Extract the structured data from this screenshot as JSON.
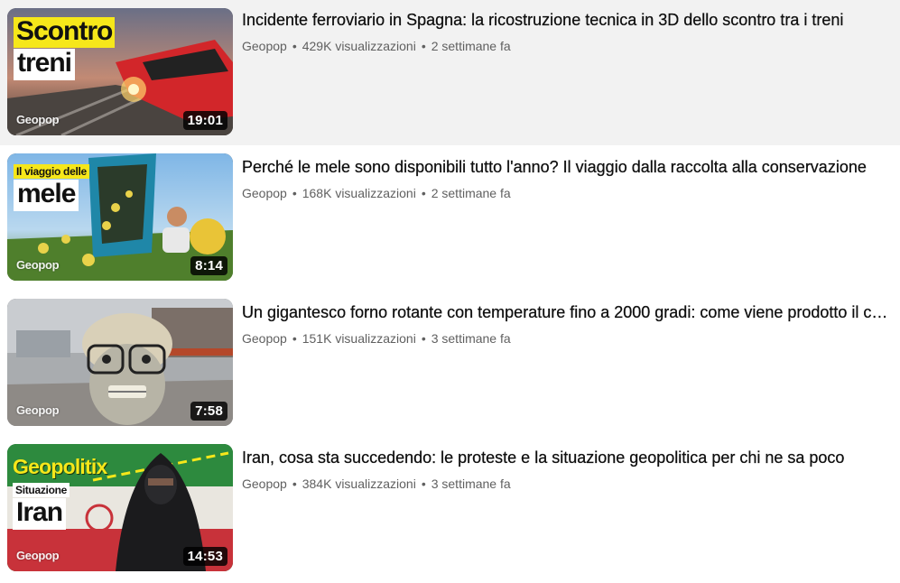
{
  "videos": [
    {
      "title": "Incidente ferroviario in Spagna: la ricostruzione tecnica in 3D dello scontro tra i treni",
      "channel": "Geopop",
      "views": "429K visualizzazioni",
      "age": "2 settimane fa",
      "duration": "19:01",
      "thumb_text_1": "Scontro",
      "thumb_text_2": "treni",
      "brand": "Geopop"
    },
    {
      "title": "Perché le mele sono disponibili tutto l'anno? Il viaggio dalla raccolta alla conservazione",
      "channel": "Geopop",
      "views": "168K visualizzazioni",
      "age": "2 settimane fa",
      "duration": "8:14",
      "thumb_text_1": "Il viaggio delle",
      "thumb_text_2": "mele",
      "brand": "Geopop"
    },
    {
      "title": "Un gigantesco forno rotante con temperature fino a 2000 gradi: come viene prodotto il cemento",
      "channel": "Geopop",
      "views": "151K visualizzazioni",
      "age": "3 settimane fa",
      "duration": "7:58",
      "brand": "Geopop"
    },
    {
      "title": "Iran, cosa sta succedendo: le proteste e la situazione geopolitica per chi ne sa poco",
      "channel": "Geopop",
      "views": "384K visualizzazioni",
      "age": "3 settimane fa",
      "duration": "14:53",
      "thumb_text_1": "Geopolitix",
      "thumb_text_2": "Situazione",
      "thumb_text_3": "Iran",
      "brand": "Geopop"
    }
  ],
  "separator": "•",
  "icons": {
    "duration_badge": "clock-overlay",
    "brand": "geopop-logo"
  },
  "colors": {
    "hover_bg": "#f2f2f2",
    "meta_text": "#606060",
    "accent_yellow": "#f6e71a"
  }
}
